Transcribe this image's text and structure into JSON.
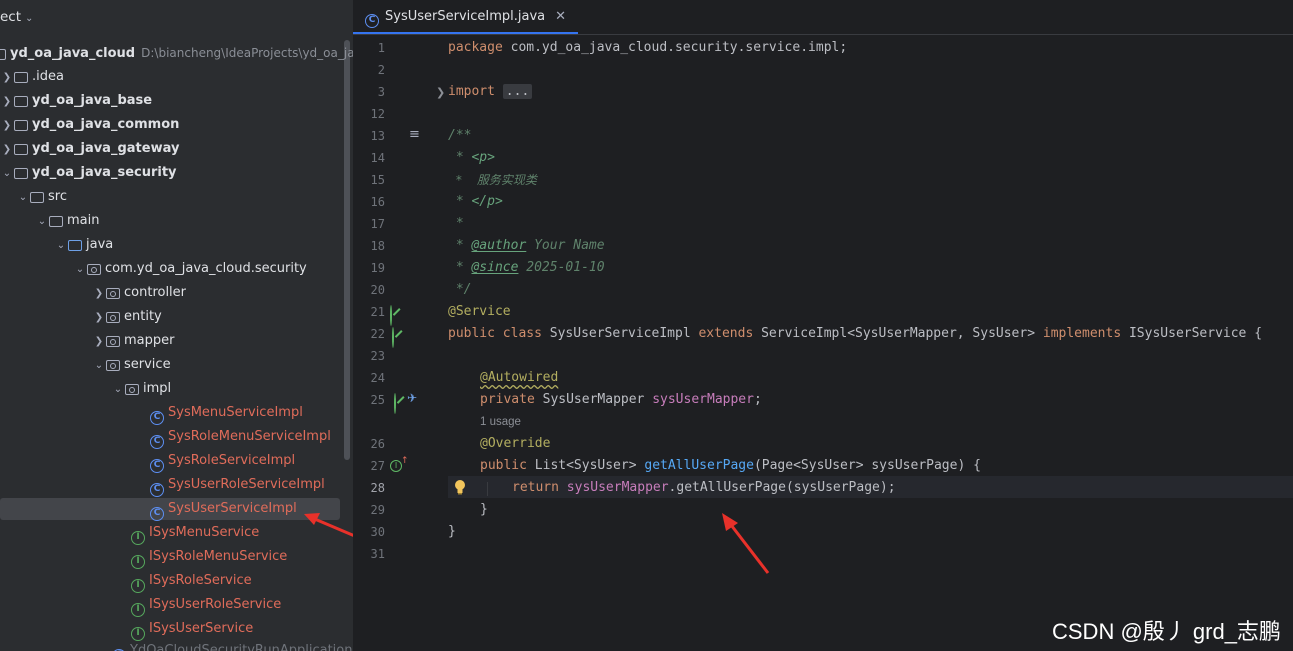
{
  "project_panel": {
    "header": "ect",
    "root": {
      "label": "yd_oa_java_cloud",
      "path": "D:\\biancheng\\IdeaProjects\\yd_oa_java"
    },
    "items": [
      {
        "label": ".idea"
      },
      {
        "label": "yd_oa_java_base"
      },
      {
        "label": "yd_oa_java_common"
      },
      {
        "label": "yd_oa_java_gateway"
      },
      {
        "label": "yd_oa_java_security"
      },
      {
        "label": "src"
      },
      {
        "label": "main"
      },
      {
        "label": "java"
      },
      {
        "label": "com.yd_oa_java_cloud.security"
      },
      {
        "label": "controller"
      },
      {
        "label": "entity"
      },
      {
        "label": "mapper"
      },
      {
        "label": "service"
      },
      {
        "label": "impl"
      },
      {
        "label": "SysMenuServiceImpl"
      },
      {
        "label": "SysRoleMenuServiceImpl"
      },
      {
        "label": "SysRoleServiceImpl"
      },
      {
        "label": "SysUserRoleServiceImpl"
      },
      {
        "label": "SysUserServiceImpl"
      },
      {
        "label": "ISysMenuService"
      },
      {
        "label": "ISysRoleMenuService"
      },
      {
        "label": "ISysRoleService"
      },
      {
        "label": "ISysUserRoleService"
      },
      {
        "label": "ISysUserService"
      },
      {
        "label": "YdOaCloudSecurityRunApplication"
      }
    ]
  },
  "editor": {
    "tab_label": "SysUserServiceImpl.java",
    "line_numbers": [
      "1",
      "2",
      "3",
      "12",
      "13",
      "14",
      "15",
      "16",
      "17",
      "18",
      "19",
      "20",
      "21",
      "22",
      "23",
      "24",
      "25",
      "26",
      "27",
      "28",
      "29",
      "30",
      "31"
    ],
    "code": {
      "l1_kw": "package",
      "l1_rest": " com.yd_oa_java_cloud.security.service.impl;",
      "l3_kw": "import",
      "l3_fold": "...",
      "l13": "/**",
      "l14_a": " * ",
      "l14_tag": "<p>",
      "l15": " *  服务实现类",
      "l16_a": " * ",
      "l16_tag": "</p>",
      "l17": " *",
      "l18_a": " * ",
      "l18_tag": "@author",
      "l18_b": " Your Name",
      "l19_a": " * ",
      "l19_tag": "@since",
      "l19_b": " 2025-01-10",
      "l20": " */",
      "l21": "@Service",
      "l22_public": "public",
      "l22_class": "class",
      "l22_name": " SysUserServiceImpl ",
      "l22_extends": "extends",
      "l22_mid": " ServiceImpl<SysUserMapper, SysUser> ",
      "l22_impl": "implements",
      "l22_end": " ISysUserService {",
      "l24": "@Autowired",
      "l25_kw": "private",
      "l25_type": " SysUserMapper ",
      "l25_field": "sysUserMapper",
      "l25_end": ";",
      "usage_hint": "1 usage",
      "l26": "@Override",
      "l27_kw": "public",
      "l27_type": " List<SysUser> ",
      "l27_method": "getAllUserPage",
      "l27_end": "(Page<SysUser> sysUserPage) {",
      "l28_kw": "return",
      "l28_field": "sysUserMapper",
      "l28_end": ".getAllUserPage(sysUserPage);",
      "l29": "}",
      "l30": "}"
    }
  },
  "watermark": "CSDN @殷丿 grd_志鹏",
  "colors": {
    "accent": "#3574f0",
    "arrow": "#e8312a"
  }
}
